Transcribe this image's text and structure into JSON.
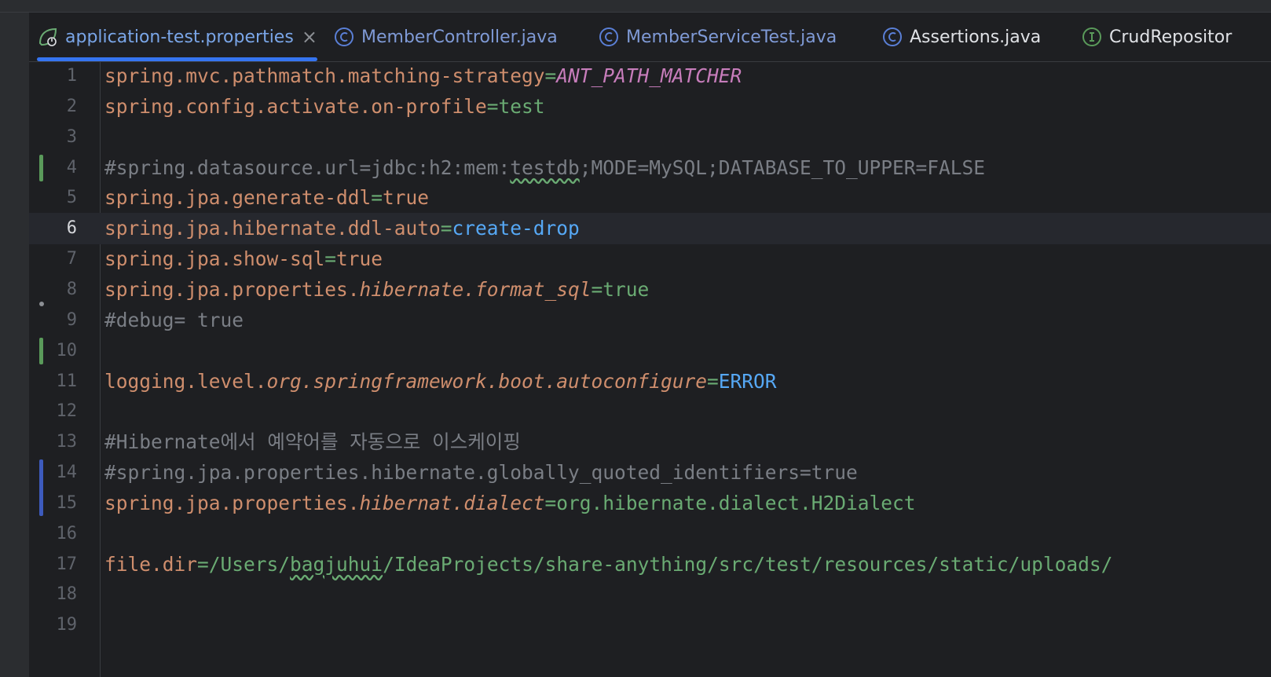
{
  "tabs": [
    {
      "label": "application-test.properties",
      "icon": "spring-leaf-icon",
      "close": "×",
      "active": true
    },
    {
      "label": "MemberController.java",
      "icon": "class-c-icon",
      "active": false
    },
    {
      "label": "MemberServiceTest.java",
      "icon": "class-c-icon",
      "active": false
    },
    {
      "label": "Assertions.java",
      "icon": "class-c-icon",
      "active": false
    },
    {
      "label": "CrudRepositor",
      "icon": "interface-i-icon",
      "active": false
    }
  ],
  "editor": {
    "current_line": 6,
    "lines": [
      {
        "n": "1",
        "parts": [
          [
            "k",
            "spring.mvc.pathmatch.matching-strategy"
          ],
          [
            "eq",
            "="
          ],
          [
            "purple",
            "ANT_PATH_MATCHER"
          ]
        ]
      },
      {
        "n": "2",
        "parts": [
          [
            "k",
            "spring.config.activate.on-profile"
          ],
          [
            "eq",
            "="
          ],
          [
            "v",
            "test"
          ]
        ]
      },
      {
        "n": "3",
        "parts": []
      },
      {
        "n": "4",
        "parts": [
          [
            "cm",
            "#spring.datasource.url=jdbc:h2:mem:"
          ],
          [
            "cm squig",
            "testdb"
          ],
          [
            "cm",
            ";MODE=MySQL;DATABASE_TO_UPPER=FALSE"
          ]
        ]
      },
      {
        "n": "5",
        "parts": [
          [
            "k",
            "spring.jpa.generate-ddl"
          ],
          [
            "eq",
            "="
          ],
          [
            "vt",
            "true"
          ]
        ]
      },
      {
        "n": "6",
        "parts": [
          [
            "k",
            "spring.jpa.hibernate.ddl-auto"
          ],
          [
            "eq",
            "="
          ],
          [
            "blue",
            "create-drop"
          ]
        ]
      },
      {
        "n": "7",
        "parts": [
          [
            "k",
            "spring.jpa.show-sql"
          ],
          [
            "eq",
            "="
          ],
          [
            "vt",
            "true"
          ]
        ]
      },
      {
        "n": "8",
        "parts": [
          [
            "k",
            "spring.jpa.properties."
          ],
          [
            "k it",
            "hibernate.format_sql"
          ],
          [
            "eq",
            "="
          ],
          [
            "v",
            "true"
          ]
        ]
      },
      {
        "n": "9",
        "parts": [
          [
            "cm",
            "#debug= true"
          ]
        ]
      },
      {
        "n": "10",
        "parts": []
      },
      {
        "n": "11",
        "parts": [
          [
            "k",
            "logging.level."
          ],
          [
            "k it",
            "org.springframework.boot.autoconfigure"
          ],
          [
            "eq",
            "="
          ],
          [
            "blue",
            "ERROR"
          ]
        ]
      },
      {
        "n": "12",
        "parts": []
      },
      {
        "n": "13",
        "parts": [
          [
            "cm",
            "#Hibernate에서 예약어를 자동으로 이스케이핑"
          ]
        ]
      },
      {
        "n": "14",
        "parts": [
          [
            "cm",
            "#spring.jpa.properties.hibernate.globally_quoted_identifiers=true"
          ]
        ]
      },
      {
        "n": "15",
        "parts": [
          [
            "k",
            "spring.jpa.properties."
          ],
          [
            "k it",
            "hibernat.dialect"
          ],
          [
            "eq",
            "="
          ],
          [
            "v",
            "org.hibernate.dialect.H2Dialect"
          ]
        ]
      },
      {
        "n": "16",
        "parts": []
      },
      {
        "n": "17",
        "parts": [
          [
            "k",
            "file.dir"
          ],
          [
            "eq",
            "="
          ],
          [
            "v",
            "/Users/"
          ],
          [
            "v squig",
            "bagjuhui"
          ],
          [
            "v",
            "/IdeaProjects/share-anything/src/test/resources/static/uploads/"
          ]
        ]
      },
      {
        "n": "18",
        "parts": []
      },
      {
        "n": "19",
        "parts": []
      }
    ]
  },
  "colors": {
    "accent": "#3574f0",
    "added_marker": "#5a9a5a",
    "modified_marker": "#3d5bbd"
  }
}
